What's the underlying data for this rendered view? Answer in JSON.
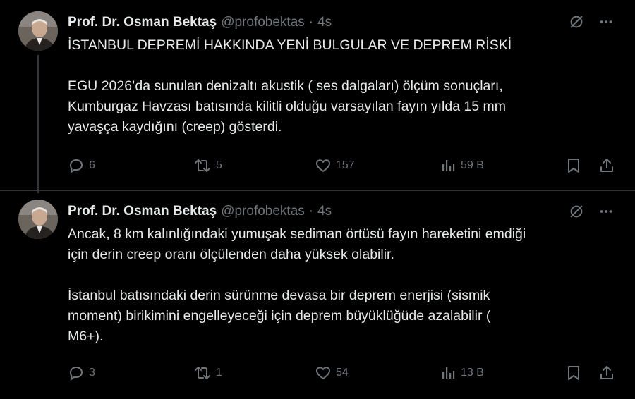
{
  "tweets": [
    {
      "author_name": "Prof. Dr. Osman Bektaş",
      "handle": "@profobektas",
      "separator": "·",
      "time": "4s",
      "lines": [
        "İSTANBUL DEPREMİ HAKKINDA YENİ BULGULAR VE DEPREM RİSKİ",
        "",
        "EGU 2026’da sunulan denizaltı akustik ( ses dalgaları) ölçüm sonuçları,",
        "Kumburgaz Havzası batısında kilitli olduğu varsayılan fayın yılda 15 mm",
        "yavaşça kaydığını (creep) gösterdi."
      ],
      "replies": "6",
      "reposts": "5",
      "likes": "157",
      "views": "59 B"
    },
    {
      "author_name": "Prof. Dr. Osman Bektaş",
      "handle": "@profobektas",
      "separator": "·",
      "time": "4s",
      "lines": [
        "Ancak, 8 km  kalınlığındaki yumuşak sediman örtüsü fayın hareketini emdiği",
        "için derin creep oranı ölçülenden daha yüksek olabilir.",
        "",
        "İstanbul batısındaki derin sürünme devasa bir deprem enerjisi (sismik",
        "moment) birikimini engelleyeceği için  deprem büyüklüğüde  azalabilir (",
        "M6+)."
      ],
      "replies": "3",
      "reposts": "1",
      "likes": "54",
      "views": "13 B"
    }
  ],
  "icons": {
    "grok": "grok-icon",
    "more": "more-icon",
    "reply": "reply-icon",
    "repost": "repost-icon",
    "like": "like-icon",
    "views": "views-icon",
    "bookmark": "bookmark-icon",
    "share": "share-icon"
  },
  "colors": {
    "background": "#000000",
    "text": "#e7e9ea",
    "secondary": "#71767b",
    "thread_line": "#333639"
  }
}
